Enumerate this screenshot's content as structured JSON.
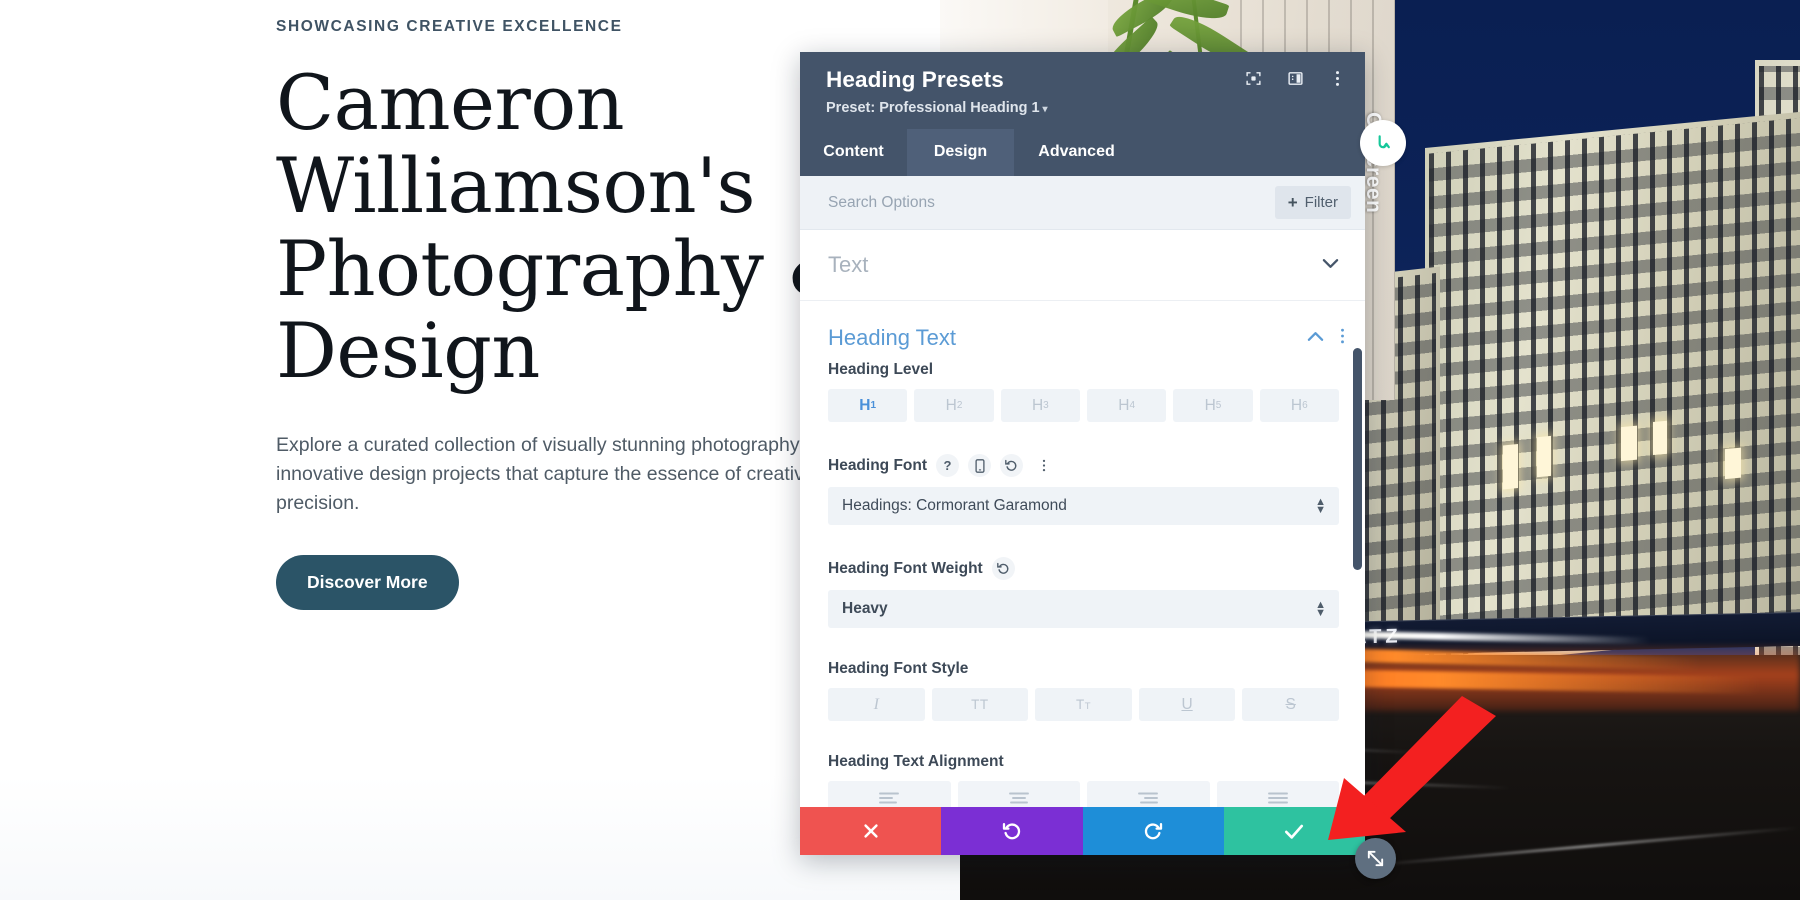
{
  "hero": {
    "eyebrow": "SHOWCASING CREATIVE EXCELLENCE",
    "title": "Cameron Williamson's Photography & Design",
    "subtitle": "Explore a curated collection of visually stunning photography and innovative design projects that capture the essence of creativity and precision.",
    "cta_label": "Discover More"
  },
  "background": {
    "sign_text": "OF  POTSDAMER  PLATZ",
    "vertical_label": "Ofiscreen"
  },
  "panel": {
    "title": "Heading Presets",
    "preset_label": "Preset: Professional Heading 1",
    "preset_caret": "▾",
    "header_icons": [
      {
        "name": "focus-target-icon"
      },
      {
        "name": "layout-columns-icon"
      },
      {
        "name": "more-vertical-icon"
      }
    ],
    "tabs": [
      {
        "label": "Content",
        "active": false
      },
      {
        "label": "Design",
        "active": true
      },
      {
        "label": "Advanced",
        "active": false
      }
    ],
    "search": {
      "placeholder": "Search Options",
      "value": "",
      "filter_label": "Filter",
      "filter_plus": "+"
    },
    "sections": [
      {
        "label": "Text",
        "state": "collapsed"
      },
      {
        "label": "Heading Text",
        "state": "expanded"
      }
    ],
    "fields": {
      "heading_level": {
        "label": "Heading Level",
        "options": [
          {
            "tag": "H",
            "num": "1",
            "active": true
          },
          {
            "tag": "H",
            "num": "2",
            "active": false
          },
          {
            "tag": "H",
            "num": "3",
            "active": false
          },
          {
            "tag": "H",
            "num": "4",
            "active": false
          },
          {
            "tag": "H",
            "num": "5",
            "active": false
          },
          {
            "tag": "H",
            "num": "6",
            "active": false
          }
        ]
      },
      "heading_font": {
        "label": "Heading Font",
        "value": "Headings: Cormorant Garamond",
        "icons": [
          "help-icon",
          "mobile-icon",
          "reset-icon",
          "more-vertical-icon"
        ]
      },
      "heading_font_weight": {
        "label": "Heading Font Weight",
        "value": "Heavy",
        "icons": [
          "reset-icon"
        ]
      },
      "heading_font_style": {
        "label": "Heading Font Style",
        "options": [
          "italic",
          "uppercase",
          "smallcaps",
          "underline",
          "strikethrough"
        ]
      },
      "heading_text_alignment": {
        "label": "Heading Text Alignment",
        "options": [
          "align-left",
          "align-center",
          "align-right",
          "align-justify"
        ]
      }
    },
    "actions": [
      {
        "name": "cancel-button",
        "icon": "close-icon",
        "color": "#ef5350"
      },
      {
        "name": "undo-button",
        "icon": "undo-icon",
        "color": "#7b2fd4"
      },
      {
        "name": "redo-button",
        "icon": "redo-icon",
        "color": "#1e8ed8"
      },
      {
        "name": "save-button",
        "icon": "check-icon",
        "color": "#2ec2a0"
      }
    ]
  },
  "overlay": {
    "resize_handle": "resize-diagonal-icon",
    "annotation_arrow": "red-arrow-annotation"
  },
  "colors": {
    "panel_header": "#44546a",
    "tab_active": "#4f6079",
    "accent_blue": "#5b9bd5",
    "cta": "#2b5467",
    "save_green": "#2ec2a0",
    "cancel_red": "#ef5350",
    "undo_purple": "#7b2fd4",
    "redo_blue": "#1e8ed8"
  }
}
